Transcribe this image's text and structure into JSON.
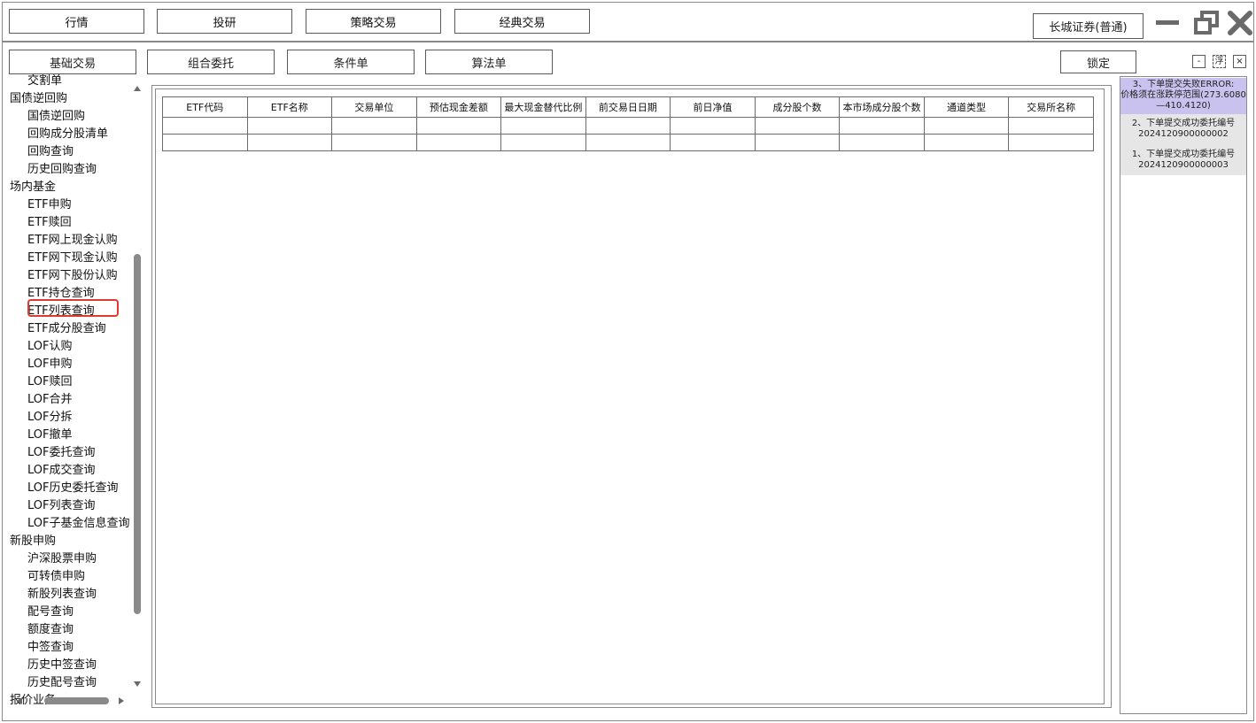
{
  "top_nav": {
    "items": [
      "行情",
      "投研",
      "策略交易",
      "经典交易"
    ]
  },
  "broker": {
    "label": "长城证券(普通)"
  },
  "sub_nav": {
    "items": [
      "基础交易",
      "组合委托",
      "条件单",
      "算法单"
    ],
    "lock_label": "锁定",
    "min_label": "-",
    "float_label": "浮",
    "close_label": "×"
  },
  "sidebar": {
    "partial_top": "交割单",
    "items": [
      {
        "label": "国债逆回购",
        "level": "group"
      },
      {
        "label": "国债逆回购",
        "level": "child"
      },
      {
        "label": "回购成分股清单",
        "level": "child"
      },
      {
        "label": "回购查询",
        "level": "child"
      },
      {
        "label": "历史回购查询",
        "level": "child"
      },
      {
        "label": "场内基金",
        "level": "group"
      },
      {
        "label": "ETF申购",
        "level": "child"
      },
      {
        "label": "ETF赎回",
        "level": "child"
      },
      {
        "label": "ETF网上现金认购",
        "level": "child"
      },
      {
        "label": "ETF网下现金认购",
        "level": "child"
      },
      {
        "label": "ETF网下股份认购",
        "level": "child"
      },
      {
        "label": "ETF持仓查询",
        "level": "child"
      },
      {
        "label": "ETF列表查询",
        "level": "child",
        "selected": true
      },
      {
        "label": "ETF成分股查询",
        "level": "child"
      },
      {
        "label": "LOF认购",
        "level": "child"
      },
      {
        "label": "LOF申购",
        "level": "child"
      },
      {
        "label": "LOF赎回",
        "level": "child"
      },
      {
        "label": "LOF合并",
        "level": "child"
      },
      {
        "label": "LOF分拆",
        "level": "child"
      },
      {
        "label": "LOF撤单",
        "level": "child"
      },
      {
        "label": "LOF委托查询",
        "level": "child"
      },
      {
        "label": "LOF成交查询",
        "level": "child"
      },
      {
        "label": "LOF历史委托查询",
        "level": "child"
      },
      {
        "label": "LOF列表查询",
        "level": "child"
      },
      {
        "label": "LOF子基金信息查询",
        "level": "child"
      },
      {
        "label": "新股申购",
        "level": "group"
      },
      {
        "label": "沪深股票申购",
        "level": "child"
      },
      {
        "label": "可转债申购",
        "level": "child"
      },
      {
        "label": "新股列表查询",
        "level": "child"
      },
      {
        "label": "配号查询",
        "level": "child"
      },
      {
        "label": "额度查询",
        "level": "child"
      },
      {
        "label": "中签查询",
        "level": "child"
      },
      {
        "label": "历史中签查询",
        "level": "child"
      },
      {
        "label": "历史配号查询",
        "level": "child"
      }
    ],
    "partial_bottom": "报价业务"
  },
  "table": {
    "columns": [
      "ETF代码",
      "ETF名称",
      "交易单位",
      "预估现金差额",
      "最大现金替代比例",
      "前交易日日期",
      "前日净值",
      "成分股个数",
      "本市场成分股个数",
      "通道类型",
      "交易所名称"
    ],
    "rows": [
      [
        "",
        "",
        "",
        "",
        "",
        "",
        "",
        "",
        "",
        "",
        ""
      ],
      [
        "",
        "",
        "",
        "",
        "",
        "",
        "",
        "",
        "",
        "",
        ""
      ]
    ]
  },
  "messages": [
    {
      "line1": "3、下单提交失败ERROR:",
      "line2": "价格须在涨跌停范围(273.6080",
      "line3": "—410.4120)",
      "type": "error"
    },
    {
      "line1": "2、下单提交成功委托编号",
      "line2": "2024120900000002",
      "type": "info"
    },
    {
      "line1": "1、下单提交成功委托编号",
      "line2": "2024120900000003",
      "type": "info"
    }
  ],
  "colors": {
    "selected_outline": "#e0392f",
    "error_bg": "#c9c2ee",
    "msg_bg": "#e6e6e6",
    "border": "#8a8a8a"
  }
}
